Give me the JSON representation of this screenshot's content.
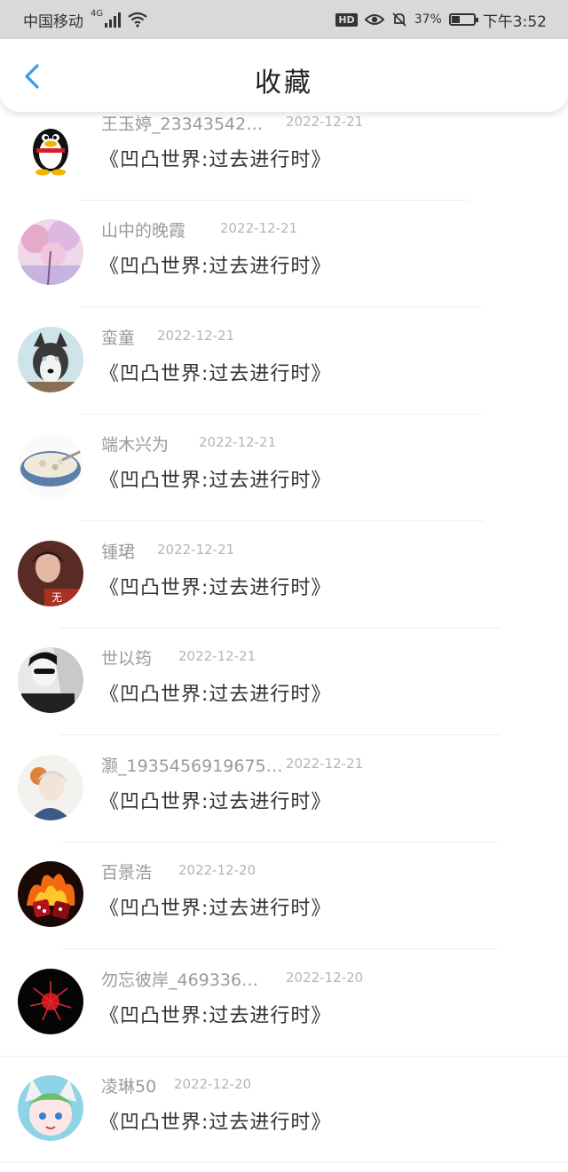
{
  "status_bar": {
    "carrier": "中国移动",
    "network": "4G",
    "battery_percent": "37%",
    "battery_level": 0.37,
    "time": "下午3:52"
  },
  "header": {
    "title": "收藏"
  },
  "favorites": [
    {
      "name": "王玉婷_23343542…",
      "date": "2022-12-21",
      "work": "《凹凸世界:过去进行时》",
      "avatar": "penguin-avatar"
    },
    {
      "name": "山中的晚霞",
      "date": "2022-12-21",
      "work": "《凹凸世界:过去进行时》",
      "avatar": "pink-blossom-avatar"
    },
    {
      "name": "蛮童",
      "date": "2022-12-21",
      "work": "《凹凸世界:过去进行时》",
      "avatar": "husky-avatar"
    },
    {
      "name": "端木兴为",
      "date": "2022-12-21",
      "work": "《凹凸世界:过去进行时》",
      "avatar": "dessert-bowl-avatar"
    },
    {
      "name": "锺珺",
      "date": "2022-12-21",
      "work": "《凹凸世界:过去进行时》",
      "avatar": "person-avatar"
    },
    {
      "name": "世以筠",
      "date": "2022-12-21",
      "work": "《凹凸世界:过去进行时》",
      "avatar": "bw-portrait-avatar"
    },
    {
      "name": "灏_1935456919675…",
      "date": "2022-12-21",
      "work": "《凹凸世界:过去进行时》",
      "avatar": "illustration-avatar"
    },
    {
      "name": "百景浩",
      "date": "2022-12-20",
      "work": "《凹凸世界:过去进行时》",
      "avatar": "fire-dice-avatar"
    },
    {
      "name": "勿忘彼岸_469336…",
      "date": "2022-12-20",
      "work": "《凹凸世界:过去进行时》",
      "avatar": "red-flower-avatar"
    },
    {
      "name": "凌琳50",
      "date": "2022-12-20",
      "work": "《凹凸世界:过去进行时》",
      "avatar": "cartoon-avatar"
    }
  ]
}
